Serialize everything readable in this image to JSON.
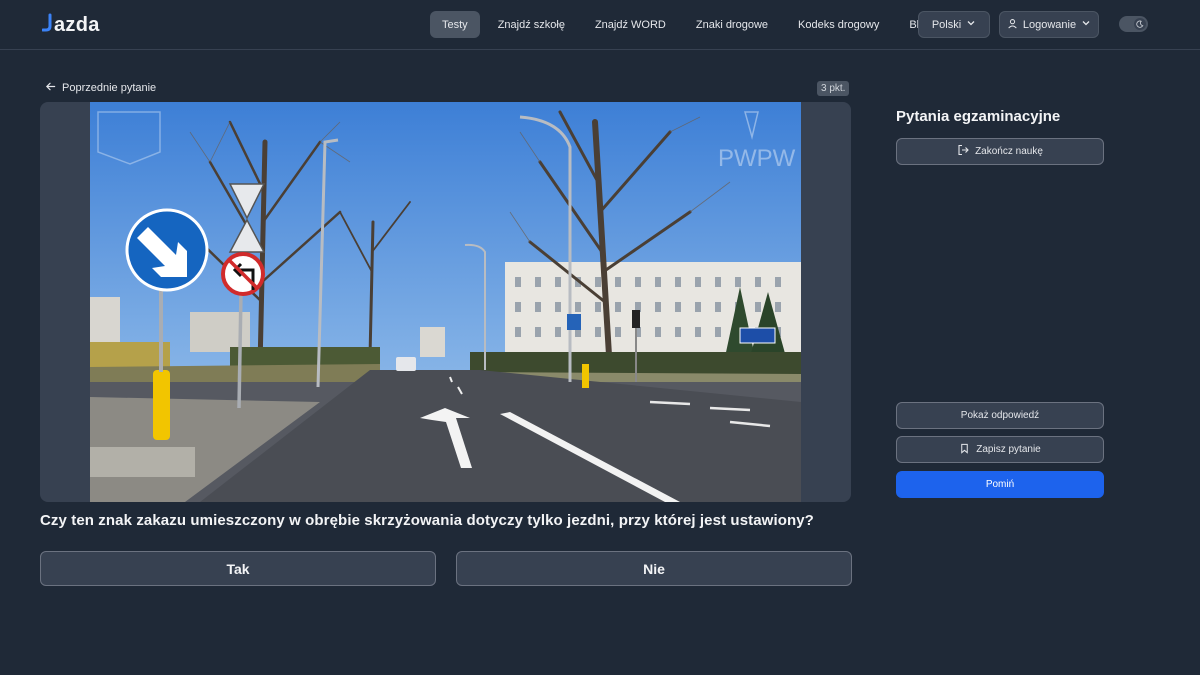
{
  "brand": {
    "logo_text": "azda"
  },
  "nav": {
    "items": [
      {
        "label": "Testy",
        "active": true
      },
      {
        "label": "Znajdź szkołę"
      },
      {
        "label": "Znajdź WORD"
      },
      {
        "label": "Znaki drogowe"
      },
      {
        "label": "Kodeks drogowy"
      },
      {
        "label": "Blog"
      }
    ],
    "language": "Polski",
    "login": "Logowanie"
  },
  "question": {
    "prev_label": "Poprzednie pytanie",
    "points": "3 pkt.",
    "text": "Czy ten znak zakazu umieszczony w obrębie skrzyżowania dotyczy tylko jezdni, przy której jest ustawiony?",
    "answers": [
      "Tak",
      "Nie"
    ],
    "image_watermarks": [
      "PWPW"
    ]
  },
  "sidebar": {
    "title": "Pytania egzaminacyjne",
    "end_label": "Zakończ naukę",
    "show_answer_label": "Pokaż odpowiedź",
    "save_label": "Zapisz pytanie",
    "skip_label": "Pomiń"
  },
  "colors": {
    "background": "#1f2937",
    "panel": "#374151",
    "accent": "#1d63ed",
    "logo_accent": "#3b82f6"
  }
}
